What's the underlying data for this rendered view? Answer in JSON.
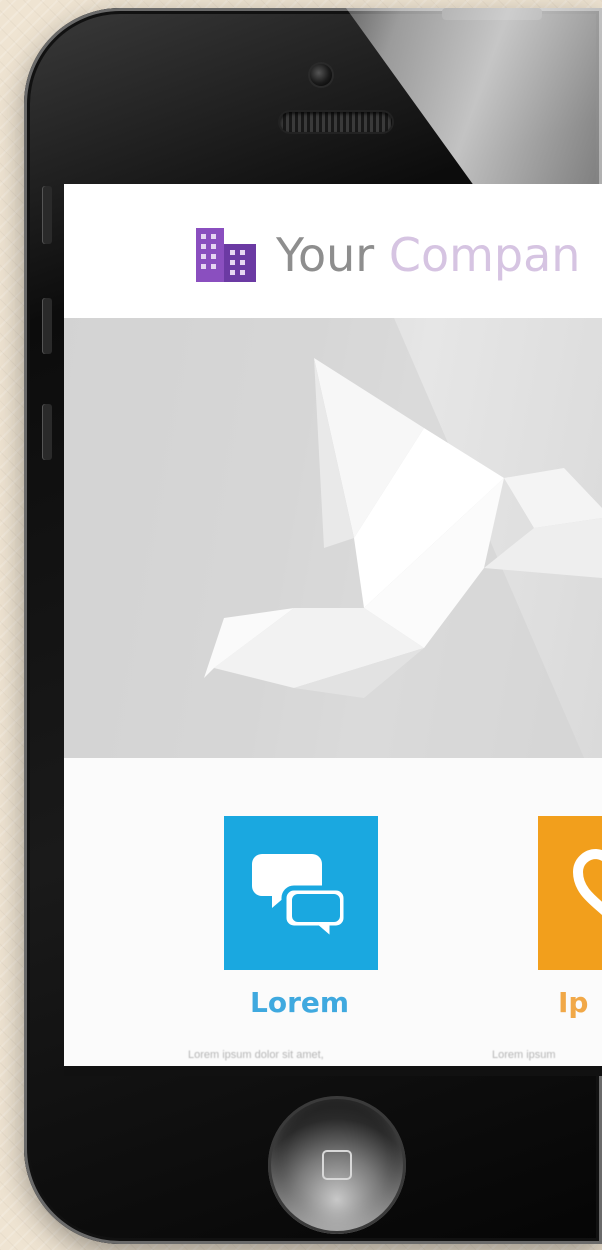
{
  "header": {
    "company_name_part1": "Your ",
    "company_name_part2": "Compan",
    "logo_icon": "building-icon"
  },
  "hero": {
    "image": "origami-bird"
  },
  "features": [
    {
      "label": "Lorem",
      "description": "Lorem ipsum dolor sit amet,",
      "icon": "chat-bubbles-icon",
      "color": "#1aa8e0"
    },
    {
      "label": "Ip",
      "description": "Lorem ipsum",
      "icon": "heart-icon",
      "color": "#f29f1c"
    }
  ],
  "colors": {
    "brand_purple": "#8a4fbf",
    "accent_blue": "#1aa8e0",
    "accent_orange": "#f29f1c"
  }
}
